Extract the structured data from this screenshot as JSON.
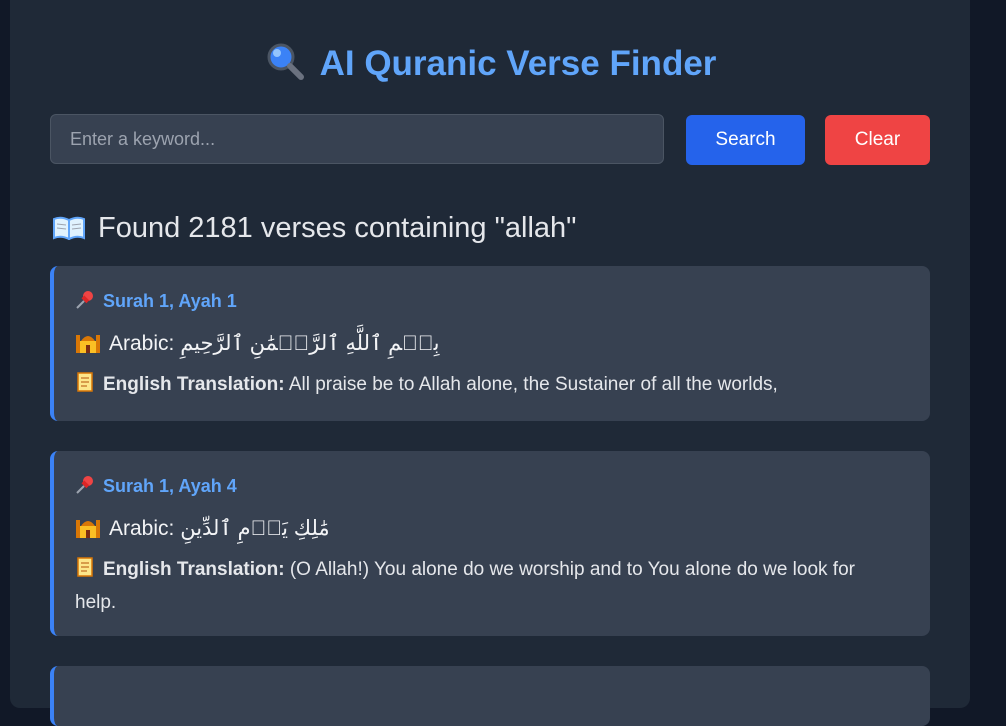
{
  "app": {
    "title": "AI Quranic Verse Finder",
    "title_icon": "magnifying-glass-icon"
  },
  "search": {
    "placeholder": "Enter a keyword...",
    "value": "",
    "search_label": "Search",
    "clear_label": "Clear"
  },
  "results": {
    "heading": "Found 2181 verses containing \"allah\"",
    "heading_icon": "open-book-icon",
    "items": [
      {
        "reference": "Surah 1, Ayah 1",
        "arabic_label": "Arabic:",
        "arabic": "بِسۡمِ ٱللَّهِ ٱلرَّحۡمَٰنِ ٱلرَّحِيمِ",
        "translation_label": "English Translation:",
        "translation": "All praise be to Allah alone, the Sustainer of all the worlds,"
      },
      {
        "reference": "Surah 1, Ayah 4",
        "arabic_label": "Arabic:",
        "arabic": "مَٰلِكِ يَوۡمِ ٱلدِّينِ",
        "translation_label": "English Translation:",
        "translation": "(O Allah!) You alone do we worship and to You alone do we look for help."
      }
    ]
  },
  "colors": {
    "page_background": "#111827",
    "panel_background": "#1f2937",
    "card_background": "#374151",
    "accent_blue": "#60a5fa",
    "search_button": "#2563eb",
    "clear_button": "#ef4444"
  }
}
